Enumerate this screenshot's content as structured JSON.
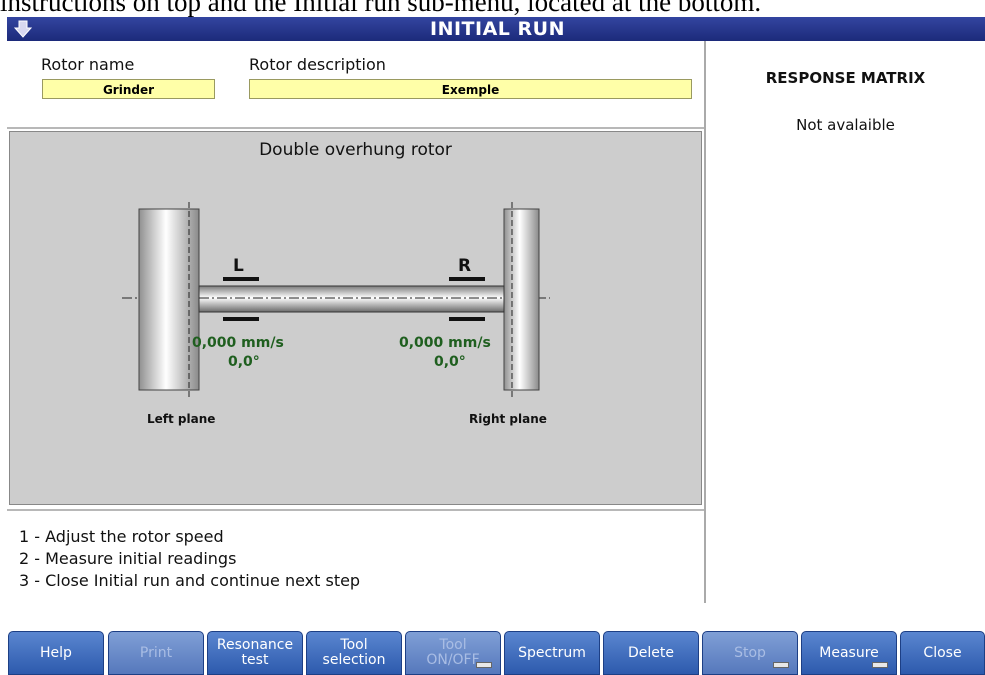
{
  "caption": "instructions on top and the Initial run sub-menu, located at the bottom.",
  "window": {
    "title": "INITIAL RUN"
  },
  "rotor": {
    "name_label": "Rotor name",
    "name_value": "Grinder",
    "description_label": "Rotor description",
    "description_value": "Exemple"
  },
  "diagram": {
    "title": "Double overhung rotor",
    "left_bearing": "L",
    "right_bearing": "R",
    "left_velocity": "0,000 mm/s",
    "left_phase": "0,0°",
    "right_velocity": "0,000 mm/s",
    "right_phase": "0,0°",
    "left_plane": "Left plane",
    "right_plane": "Right plane"
  },
  "instructions": [
    "1 - Adjust the rotor speed",
    "2 - Measure initial readings",
    "3 - Close Initial run and continue next step"
  ],
  "response_matrix": {
    "title": "RESPONSE MATRIX",
    "status": "Not avalaible"
  },
  "toolbar": {
    "help": "Help",
    "print": "Print",
    "resonance_1": "Resonance",
    "resonance_2": "test",
    "tool_sel_1": "Tool",
    "tool_sel_2": "selection",
    "tool_onoff_1": "Tool",
    "tool_onoff_2": "ON/OFF",
    "spectrum": "Spectrum",
    "delete": "Delete",
    "stop": "Stop",
    "measure": "Measure",
    "close": "Close"
  },
  "colors": {
    "titlebar": "#2a3a90",
    "field": "#ffffa8",
    "button": "#3f6fc2",
    "readout": "#1f5f1f"
  }
}
